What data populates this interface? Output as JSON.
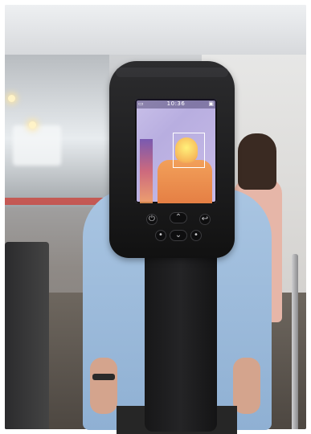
{
  "screen": {
    "time": "10:36"
  },
  "buttons": {
    "left_icon": "power-icon",
    "up_icon": "chevron-up-icon",
    "right_icon": "return-icon",
    "down_icon": "chevron-down-icon",
    "center_icon": "dot-icon"
  },
  "colors": {
    "device_body": "#1a1a1b",
    "screen_bg": "#c9c0e9",
    "thermal_hot": "#fff17a",
    "thermal_warm": "#e57f44",
    "shirt": "#a9c5e2"
  }
}
